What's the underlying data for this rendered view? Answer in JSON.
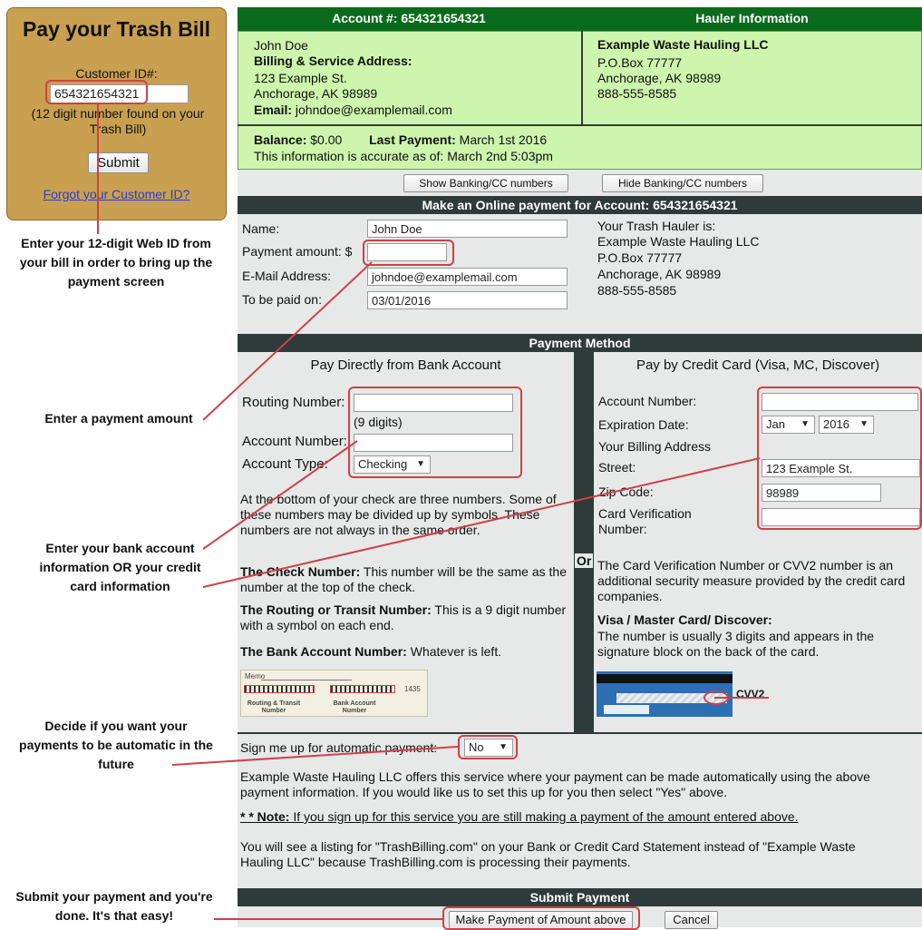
{
  "left_panel": {
    "title": "Pay your Trash Bill",
    "customer_id_label": "Customer ID#:",
    "customer_id_value": "654321654321",
    "hint": "(12 digit number found on your Trash Bill)",
    "submit_label": "Submit",
    "forgot_link": "Forgot your Customer ID?"
  },
  "callouts": {
    "web_id": "Enter your 12-digit Web ID from your bill in order to bring up the payment screen",
    "payment_amount": "Enter a payment amount",
    "bank_info": "Enter your bank account information OR your credit card information",
    "automatic": "Decide if you want your payments to be automatic in the future",
    "submit": "Submit your payment and you're done.  It's that easy!"
  },
  "account": {
    "header": "Account #: 654321654321",
    "name": "John Doe",
    "address_label": "Billing & Service Address:",
    "street": "123 Example St.",
    "city": "Anchorage, AK 98989",
    "email_label": "Email:",
    "email": "johndoe@examplemail.com"
  },
  "hauler": {
    "header": "Hauler Information",
    "name": "Example Waste Hauling LLC",
    "po": "P.O.Box 77777",
    "city": "Anchorage, AK 98989",
    "phone": "888-555-8585"
  },
  "balance": {
    "balance_label": "Balance:",
    "balance_value": "$0.00",
    "last_payment_label": "Last Payment:",
    "last_payment_value": "March 1st 2016",
    "accuracy": "This information is accurate as of: March 2nd 5:03pm"
  },
  "toggles": {
    "show": "Show Banking/CC numbers",
    "hide": "Hide Banking/CC numbers"
  },
  "online_payment": {
    "header": "Make an Online payment for Account: 654321654321",
    "name_label": "Name:",
    "name_value": "John Doe",
    "amount_label": "Payment amount: $",
    "amount_value": "",
    "email_label": "E-Mail Address:",
    "email_value": "johndoe@examplemail.com",
    "date_label": "To be paid on:",
    "date_value": "03/01/2016",
    "hauler_intro": "Your Trash Hauler is:",
    "hauler_name": "Example Waste Hauling LLC",
    "hauler_po": "P.O.Box 77777",
    "hauler_city": "Anchorage, AK 98989",
    "hauler_phone": "888-555-8585"
  },
  "payment_method": {
    "header": "Payment Method",
    "or": "Or",
    "bank": {
      "title": "Pay Directly from Bank Account",
      "routing_label": "Routing Number:",
      "routing_hint": "(9 digits)",
      "account_label": "Account Number:",
      "type_label": "Account Type:",
      "type_value": "Checking",
      "info": "At the bottom of your check are three numbers. Some of these numbers may be divided up by symbols. These numbers are not always in the same order.",
      "check_label": "The Check Number:",
      "check_text": " This number will be the same as the number at the top of the check.",
      "routing_bold": "The Routing or Transit Number:",
      "routing_text": " This is a 9 digit number with a symbol on each end.",
      "account_bold": "The Bank Account Number:",
      "account_text": " Whatever is left.",
      "check_img_memo": "Memo",
      "check_img_routing": "Routing & Transit Number",
      "check_img_account": "Bank Account Number",
      "check_img_num": "1435"
    },
    "card": {
      "title": "Pay by Credit Card (Visa, MC, Discover)",
      "account_label": "Account Number:",
      "exp_label": "Expiration Date:",
      "exp_month": "Jan",
      "exp_year": "2016",
      "billing_label": "Your Billing Address",
      "street_label": "Street:",
      "street_value": "123 Example St.",
      "zip_label": "Zip Code:",
      "zip_value": "98989",
      "cvv_label": "Card Verification Number:",
      "cvv_info": "The Card Verification Number or CVV2 number is an additional security measure provided by the credit card companies.",
      "visa_bold": "Visa / Master Card/ Discover:",
      "visa_text": "The number is usually 3 digits and appears in the signature block on the back of the card.",
      "cvv2_label": "CVV2"
    }
  },
  "autopay": {
    "label": "Sign me up for automatic payment:",
    "value": "No",
    "desc": "Example Waste Hauling LLC offers this service where your payment can be made automatically using the above payment information. If you would like us to set this up for you then select \"Yes\" above.",
    "note_prefix": "* * Note:",
    "note_text": " If you sign up for this service you are still making a payment of the amount entered above.",
    "listing": "You will see a listing for \"TrashBilling.com\" on your Bank or Credit Card Statement instead of \"Example Waste Hauling LLC\" because TrashBilling.com is processing their payments."
  },
  "submit_payment": {
    "header": "Submit Payment",
    "make_payment": "Make Payment of Amount above",
    "cancel": "Cancel"
  },
  "colors": {
    "header_green": "#0a6b1c",
    "light_green": "#cdf5ad",
    "panel_gold": "#c9a050",
    "dark_bar": "#2f3b3a",
    "highlight_red": "#d0404a",
    "form_gray": "#e6e9e8"
  }
}
